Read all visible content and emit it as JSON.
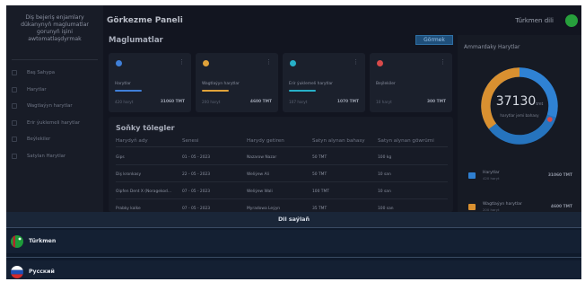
{
  "brand": {
    "text": "Diş bejeriş enjamlary dükanynyň maglumatlar gorunyň işini awtomatlaşdyrmak"
  },
  "sidebar": {
    "items": [
      {
        "label": "Baş Sahypa",
        "icon": "home-icon"
      },
      {
        "label": "Harytlar",
        "icon": "box-icon"
      },
      {
        "label": "Wagtlaýyn harytlar",
        "icon": "clock-icon"
      },
      {
        "label": "Erir ýuklemeli harytlar",
        "icon": "upload-icon"
      },
      {
        "label": "Beýlekiler",
        "icon": "grid-icon"
      },
      {
        "label": "Satylan Harytlar",
        "icon": "cart-icon"
      }
    ]
  },
  "header": {
    "title": "Görkezme Paneli",
    "language": "Türkmen dili"
  },
  "info": {
    "title": "Maglumatlar",
    "show_button": "Görmek",
    "cards": [
      {
        "name": "Harytlar",
        "count": "420 haryt",
        "total": "31060 TMT",
        "color": "#3f7fd8",
        "icon": "box-icon"
      },
      {
        "name": "Wagtlaýyn harytlar",
        "count": "200 haryt",
        "total": "4600 TMT",
        "color": "#e0a23a",
        "icon": "clock-icon"
      },
      {
        "name": "Erir ýuklemeli harytlar",
        "count": "107 haryt",
        "total": "1070 TMT",
        "color": "#27b0c8",
        "icon": "upload-icon"
      },
      {
        "name": "Beýlekiler",
        "count": "10 haryt",
        "total": "300 TMT",
        "color": "#d84a4a",
        "icon": "grid-icon"
      }
    ]
  },
  "recent": {
    "title": "Soňky tölegler",
    "headers": [
      "Harydyň ady",
      "Senesi",
      "Harydy getiren",
      "Satyn alynan bahasy",
      "Satyn alynan göwrümi"
    ],
    "rows": [
      [
        "Gips",
        "01 - 05 - 2023",
        "Nazarow Nazar",
        "50 TMT",
        "100 kg"
      ],
      [
        "Diş kronkasy",
        "22 - 05 - 2023",
        "Weliýew Ali",
        "50 TMT",
        "10 san"
      ],
      [
        "Oipfen Dent X (Noragekod...",
        "07 - 05 - 2023",
        "Weliýew Wali",
        "100 TMT",
        "10 san"
      ],
      [
        "Prabky kalke",
        "07 - 05 - 2023",
        "Myradowa Leýyn",
        "35 TMT",
        "100 san"
      ]
    ]
  },
  "stock": {
    "title": "Ammardaky Harytlar",
    "total": "37130",
    "unit": "tmt",
    "subtitle": "harytlar jemi bahasy",
    "legend": [
      {
        "name": "Harytlar",
        "count": "420 haryt",
        "total": "31060 TMT",
        "color": "#2f7fd0",
        "icon": "box-icon"
      },
      {
        "name": "Wagtlaýyn harytlar",
        "count": "200 haryt",
        "total": "4600 TMT",
        "color": "#d99030",
        "icon": "clock-icon"
      }
    ]
  },
  "language_sheet": {
    "title": "Dil saýlaň",
    "options": [
      {
        "label": "Türkmen",
        "flag": "turkmenistan-flag-icon"
      },
      {
        "label": "Русский",
        "flag": "russia-flag-icon"
      }
    ]
  }
}
